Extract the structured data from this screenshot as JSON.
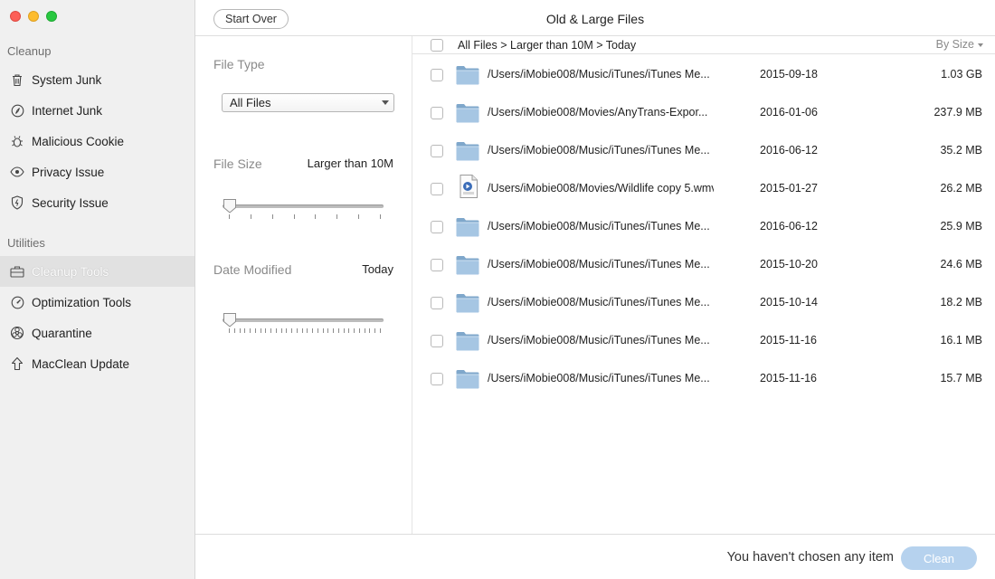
{
  "window": {
    "title": "Old & Large Files"
  },
  "header": {
    "start_over_label": "Start Over"
  },
  "sidebar": {
    "sections": [
      {
        "label": "Cleanup"
      },
      {
        "label": "Utilities"
      }
    ],
    "items": [
      {
        "label": "System Junk",
        "icon": "trash-icon"
      },
      {
        "label": "Internet Junk",
        "icon": "compass-icon"
      },
      {
        "label": "Malicious Cookie",
        "icon": "bug-icon"
      },
      {
        "label": "Privacy Issue",
        "icon": "eye-icon"
      },
      {
        "label": "Security Issue",
        "icon": "shield-icon"
      },
      {
        "label": "Cleanup Tools",
        "icon": "toolbox-icon",
        "active": true
      },
      {
        "label": "Optimization Tools",
        "icon": "gauge-icon"
      },
      {
        "label": "Quarantine",
        "icon": "biohazard-icon"
      },
      {
        "label": "MacClean Update",
        "icon": "arrow-up-icon"
      }
    ]
  },
  "filters": {
    "file_type": {
      "label": "File Type",
      "selected": "All Files"
    },
    "file_size": {
      "label": "File Size",
      "value": "Larger than 10M",
      "position": 0.0,
      "tick_count": 8
    },
    "date_modified": {
      "label": "Date Modified",
      "value": "Today",
      "position": 0.0,
      "tick_count": 30
    }
  },
  "list": {
    "breadcrumb": "All Files > Larger than 10M > Today",
    "sort_label": "By Size",
    "rows": [
      {
        "path": "/Users/iMobie008/Music/iTunes/iTunes Me...",
        "date": "2015-09-18",
        "size": "1.03 GB",
        "icon": "folder-icon"
      },
      {
        "path": "/Users/iMobie008/Movies/AnyTrans-Expor...",
        "date": "2016-01-06",
        "size": "237.9 MB",
        "icon": "folder-icon"
      },
      {
        "path": "/Users/iMobie008/Music/iTunes/iTunes Me...",
        "date": "2016-06-12",
        "size": "35.2 MB",
        "icon": "folder-icon"
      },
      {
        "path": "/Users/iMobie008/Movies/Wildlife copy 5.wmv",
        "date": "2015-01-27",
        "size": "26.2 MB",
        "icon": "video-file-icon"
      },
      {
        "path": "/Users/iMobie008/Music/iTunes/iTunes Me...",
        "date": "2016-06-12",
        "size": "25.9 MB",
        "icon": "folder-icon"
      },
      {
        "path": "/Users/iMobie008/Music/iTunes/iTunes Me...",
        "date": "2015-10-20",
        "size": "24.6 MB",
        "icon": "folder-icon"
      },
      {
        "path": "/Users/iMobie008/Music/iTunes/iTunes Me...",
        "date": "2015-10-14",
        "size": "18.2 MB",
        "icon": "folder-icon"
      },
      {
        "path": "/Users/iMobie008/Music/iTunes/iTunes Me...",
        "date": "2015-11-16",
        "size": "16.1 MB",
        "icon": "folder-icon"
      },
      {
        "path": "/Users/iMobie008/Music/iTunes/iTunes Me...",
        "date": "2015-11-16",
        "size": "15.7 MB",
        "icon": "folder-icon"
      }
    ]
  },
  "footer": {
    "status": "You haven't chosen any item",
    "clean_label": "Clean"
  },
  "colors": {
    "close": "#fc5f57",
    "minimize": "#fdbc2e",
    "maximize": "#28c840",
    "clean_button": "#b6d2ee",
    "folder": "#8fb5d6"
  }
}
